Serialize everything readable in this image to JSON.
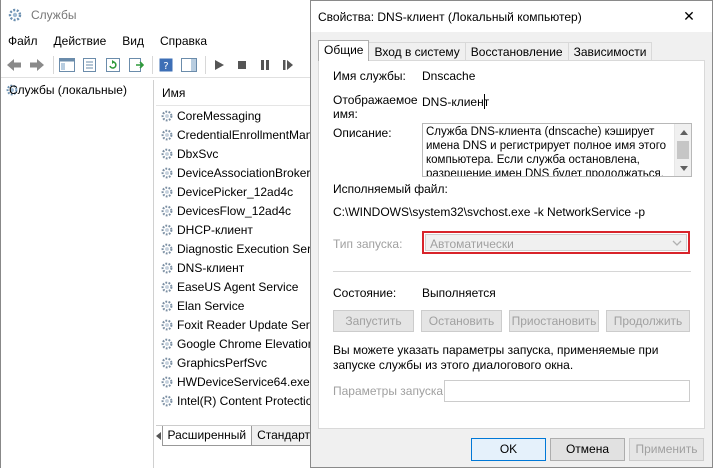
{
  "services_window": {
    "title": "Службы",
    "menu": [
      "Файл",
      "Действие",
      "Вид",
      "Справка"
    ],
    "tree": {
      "root_label": "Службы (локальные)"
    },
    "list": {
      "column_name": "Имя",
      "rows": [
        "CoreMessaging",
        "CredentialEnrollmentMan",
        "DbxSvc",
        "DeviceAssociationBroker_",
        "DevicePicker_12ad4c",
        "DevicesFlow_12ad4c",
        "DHCP-клиент",
        "Diagnostic Execution Serv",
        "DNS-клиент",
        "EaseUS Agent Service",
        "Elan Service",
        "Foxit Reader Update Serv",
        "Google Chrome Elevation",
        "GraphicsPerfSvc",
        "HWDeviceService64.exe",
        "Intel(R) Content Protectio"
      ]
    },
    "bottom_tabs": [
      "Расширенный",
      "Стандарт"
    ]
  },
  "dialog": {
    "title": "Свойства: DNS-клиент (Локальный компьютер)",
    "close_glyph": "✕",
    "tabs": [
      "Общие",
      "Вход в систему",
      "Восстановление",
      "Зависимости"
    ],
    "service_name_label": "Имя службы:",
    "service_name_value": "Dnscache",
    "display_name_label": "Отображаемое имя:",
    "display_name_value": "DNS-клиент",
    "description_label": "Описание:",
    "description_value": "Служба DNS-клиента (dnscache) кэширует имена DNS и регистрирует полное имя этого компьютера. Если служба остановлена, разрешение имен DNS будет продолжаться, но",
    "exe_label": "Исполняемый файл:",
    "exe_value": "C:\\WINDOWS\\system32\\svchost.exe -k NetworkService -p",
    "startup_type_label": "Тип запуска:",
    "startup_type_value": "Автоматически",
    "status_label": "Состояние:",
    "status_value": "Выполняется",
    "buttons": {
      "start": "Запустить",
      "stop": "Остановить",
      "pause": "Приостановить",
      "resume": "Продолжить"
    },
    "hint_text": "Вы можете указать параметры запуска, применяемые при запуске службы из этого диалогового окна.",
    "params_label": "Параметры запуска:",
    "params_value": "",
    "footer": {
      "ok": "OK",
      "cancel": "Отмена",
      "apply": "Применить"
    },
    "colors": {
      "highlight_border": "#d8242b",
      "default_button_border": "#0078d7"
    }
  }
}
